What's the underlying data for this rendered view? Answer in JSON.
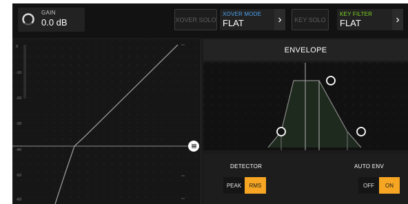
{
  "gain": {
    "label": "GAIN",
    "value": "0.0 dB"
  },
  "xover_solo": {
    "label": "XOVER SOLO"
  },
  "xover_mode": {
    "label": "XOVER MODE",
    "value": "FLAT",
    "label_color": "#4ea3f0"
  },
  "key_solo": {
    "label": "KEY SOLO"
  },
  "key_filter": {
    "label": "KEY FILTER",
    "value": "FLAT",
    "label_color": "#7ed321"
  },
  "graph": {
    "ticks": [
      "0",
      "-10",
      "-20",
      "-30",
      "-40",
      "-50",
      "-60"
    ],
    "handle_icon": "menu-icon"
  },
  "envelope": {
    "title": "ENVELOPE"
  },
  "detector": {
    "label": "DETECTOR",
    "options": [
      "PEAK",
      "RMS"
    ],
    "selected": "RMS"
  },
  "auto_env": {
    "label": "AUTO ENV",
    "options": [
      "OFF",
      "ON"
    ],
    "selected": "ON"
  },
  "colors": {
    "accent": "#f6a623",
    "background": "#1a1a1a",
    "curve": "#9a9a9a"
  }
}
